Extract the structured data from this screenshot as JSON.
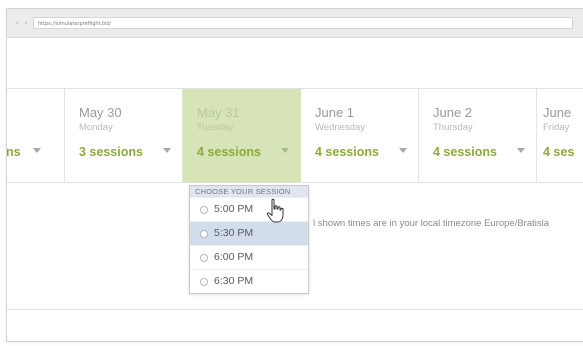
{
  "browser": {
    "back_glyph": "‹",
    "forward_glyph": "›",
    "url": "https://simulatorpreflight.biz/"
  },
  "days": [
    {
      "date": "",
      "weekday": "",
      "sessions": "ns",
      "selected": false
    },
    {
      "date": "May 30",
      "weekday": "Monday",
      "sessions": "3 sessions",
      "selected": false
    },
    {
      "date": "May 31",
      "weekday": "Tuesday",
      "sessions": "4 sessions",
      "selected": true
    },
    {
      "date": "June 1",
      "weekday": "Wednesday",
      "sessions": "4 sessions",
      "selected": false
    },
    {
      "date": "June 2",
      "weekday": "Thursday",
      "sessions": "4 sessions",
      "selected": false
    },
    {
      "date": "June",
      "weekday": "Friday",
      "sessions": "4 ses",
      "selected": false
    }
  ],
  "dropdown": {
    "header": "CHOOSE YOUR SESSION",
    "options": [
      "5:00 PM",
      "5:30 PM",
      "6:00 PM",
      "6:30 PM"
    ],
    "hovered_index": 1
  },
  "timezone_note": "l shown times are in your local timezone Europe/Bratisla",
  "colors": {
    "accent_green": "#8aab3c",
    "selected_bg": "#d6e4b8",
    "hover_bg": "#d3dcea"
  },
  "icons": {
    "cursor": "hand-pointer-icon",
    "caret": "caret-down-icon",
    "radio": "radio-icon"
  }
}
